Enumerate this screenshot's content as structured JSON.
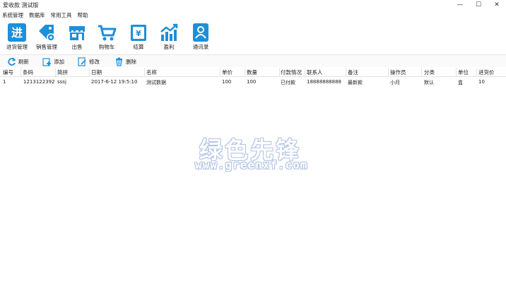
{
  "window": {
    "title": "爱收款 测试版",
    "minimize": "—",
    "maximize": "☐",
    "close": "✕"
  },
  "menu": {
    "items": [
      "系统管理",
      "数据库",
      "常用工具",
      "帮助"
    ]
  },
  "toolbar": {
    "accent": "#1e8fd8",
    "items": [
      {
        "label": "进货管理",
        "icon": "stock-in-icon"
      },
      {
        "label": "销售管理",
        "icon": "sales-tag-icon"
      },
      {
        "label": "出售",
        "icon": "shop-icon"
      },
      {
        "label": "购物车",
        "icon": "cart-icon"
      },
      {
        "label": "结算",
        "icon": "wallet-icon"
      },
      {
        "label": "盈利",
        "icon": "chart-icon"
      },
      {
        "label": "通讯录",
        "icon": "contacts-icon"
      }
    ]
  },
  "subtoolbar": {
    "refresh": "刷新",
    "add": "添加",
    "edit": "修改",
    "delete": "删除"
  },
  "grid": {
    "headers": [
      "编号",
      "条码",
      "简拼",
      "日期",
      "名称",
      "单价",
      "数量",
      "付款情况",
      "联系人",
      "备注",
      "操作员",
      "分类",
      "单位",
      "进货价"
    ],
    "rows": [
      [
        "1",
        "1213122392",
        "sssj",
        "2017-6-12 19:5:10",
        "测试数据",
        "100",
        "100",
        "已付款",
        "18888888888",
        "最新款",
        "小月",
        "默认",
        "盒",
        "10"
      ]
    ]
  },
  "watermark": {
    "title": "绿色先锋",
    "url": "www.greenxf.com"
  }
}
